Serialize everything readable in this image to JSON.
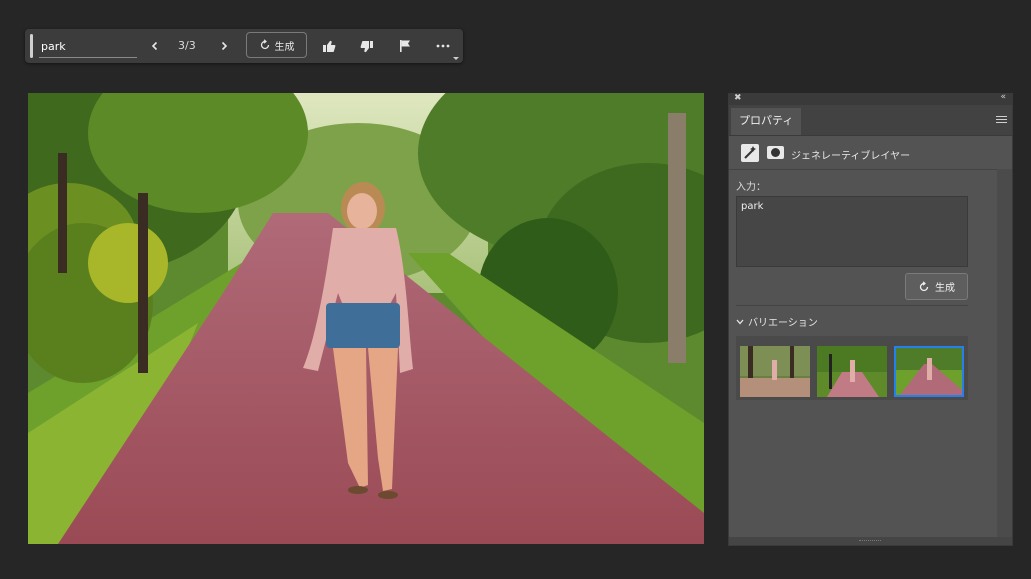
{
  "taskbar": {
    "prompt_value": "park",
    "counter": "3/3",
    "generate_label": "生成"
  },
  "panel": {
    "tab_label": "プロパティ",
    "layer_type_label": "ジェネレーティブレイヤー",
    "input_label": "入力：",
    "prompt_value": "park",
    "generate_label": "生成",
    "variations_label": "バリエーション",
    "variations": [
      {
        "selected": false
      },
      {
        "selected": false
      },
      {
        "selected": true
      }
    ]
  },
  "colors": {
    "accent": "#2680eb",
    "panel_bg": "#535353",
    "app_bg": "#262626"
  },
  "icons": [
    "chevron-left-icon",
    "chevron-right-icon",
    "regenerate-icon",
    "thumbs-up-icon",
    "thumbs-down-icon",
    "flag-icon",
    "more-icon",
    "close-icon",
    "collapse-icon",
    "panel-menu-icon",
    "generative-layer-icon",
    "mask-icon",
    "chevron-down-icon"
  ]
}
